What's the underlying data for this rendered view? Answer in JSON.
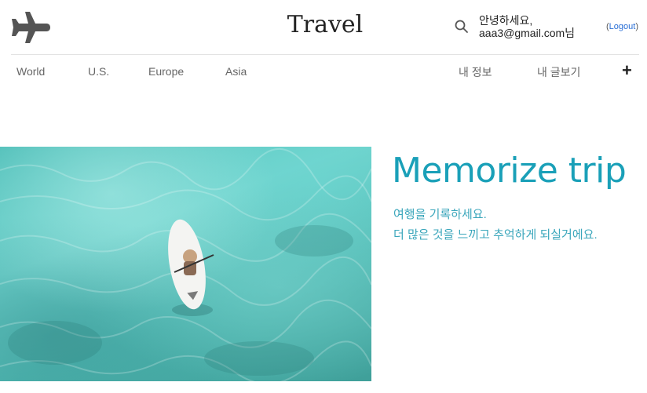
{
  "header": {
    "logo_icon": "airplane-icon",
    "brand": "Travel",
    "search_icon": "search-icon",
    "greeting_line1": "안녕하세요,",
    "greeting_line2": "aaa3@gmail.com님",
    "logout_open": "(",
    "logout_label": "Logout",
    "logout_close": ")"
  },
  "nav": {
    "left": [
      {
        "label": "World"
      },
      {
        "label": "U.S."
      },
      {
        "label": "Europe"
      },
      {
        "label": "Asia"
      }
    ],
    "right": [
      {
        "label": "내 정보"
      },
      {
        "label": "내 글보기"
      }
    ],
    "add_label": "+",
    "add_icon": "plus-icon"
  },
  "hero": {
    "image": "aerial photo of person on paddleboard in turquoise water",
    "title": "Memorize trip",
    "line1": "여행을 기록하세요.",
    "line2": "더 많은 것을 느끼고 추억하게 되실거에요."
  },
  "colors": {
    "accent": "#1aa0b8",
    "link": "#2a6fd6",
    "logo": "#555555"
  }
}
